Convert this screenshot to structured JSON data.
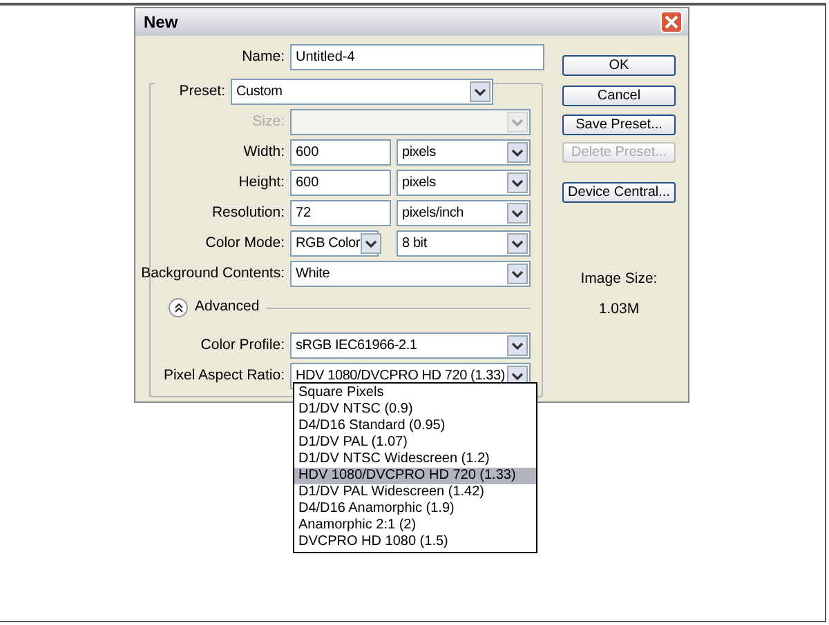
{
  "window": {
    "title": "New"
  },
  "name": {
    "label": "Name:",
    "value": "Untitled-4"
  },
  "preset": {
    "label": "Preset:",
    "value": "Custom"
  },
  "rows": [
    {
      "label": "Size:",
      "disabled": true,
      "fields": [
        {
          "kind": "select"
        }
      ]
    },
    {
      "label": "Width:",
      "disabled": false,
      "fields": [
        {
          "kind": "text",
          "value": "600"
        },
        {
          "kind": "select",
          "value": "pixels"
        }
      ]
    },
    {
      "label": "Height:",
      "disabled": false,
      "fields": [
        {
          "kind": "text",
          "value": "600"
        },
        {
          "kind": "select",
          "value": "pixels"
        }
      ]
    },
    {
      "label": "Resolution:",
      "disabled": false,
      "fields": [
        {
          "kind": "text",
          "value": "72"
        },
        {
          "kind": "select",
          "value": "pixels/inch"
        }
      ]
    },
    {
      "label": "Color Mode:",
      "disabled": false,
      "fields": [
        {
          "kind": "select",
          "value": "RGB Color"
        },
        {
          "kind": "select",
          "value": "8 bit"
        }
      ]
    },
    {
      "label": "Background Contents:",
      "disabled": false,
      "fields": [
        {
          "kind": "select",
          "value": "White"
        }
      ]
    }
  ],
  "advanced": {
    "label": "Advanced",
    "expanded": true
  },
  "advanced_rows": [
    {
      "label": "Color Profile:",
      "disabled": false,
      "fields": [
        {
          "kind": "select",
          "value": "sRGB IEC61966-2.1"
        }
      ]
    },
    {
      "label": "Pixel Aspect Ratio:",
      "disabled": false,
      "fields": [
        {
          "kind": "select",
          "value": "HDV 1080/DVCPRO HD 720 (1.33)"
        }
      ]
    }
  ],
  "buttons": [
    {
      "label": "OK",
      "disabled": false
    },
    {
      "label": "Cancel",
      "disabled": false
    },
    {
      "label": "Save Preset...",
      "disabled": false
    },
    {
      "label": "Delete Preset...",
      "disabled": true
    },
    {
      "label": "Device Central...",
      "disabled": false
    }
  ],
  "image_size": {
    "label": "Image Size:",
    "value": "1.03M"
  },
  "dropdown": {
    "options": [
      {
        "label": "Square Pixels",
        "selected": false
      },
      {
        "label": "D1/DV NTSC (0.9)",
        "selected": false
      },
      {
        "label": "D4/D16 Standard (0.95)",
        "selected": false
      },
      {
        "label": "D1/DV PAL (1.07)",
        "selected": false
      },
      {
        "label": "D1/DV NTSC Widescreen (1.2)",
        "selected": false
      },
      {
        "label": "HDV 1080/DVCPRO HD 720 (1.33)",
        "selected": true
      },
      {
        "label": "D1/DV PAL Widescreen (1.42)",
        "selected": false
      },
      {
        "label": "D4/D16 Anamorphic (1.9)",
        "selected": false
      },
      {
        "label": "Anamorphic 2:1 (2)",
        "selected": false
      },
      {
        "label": "DVCPRO HD 1080 (1.5)",
        "selected": false
      }
    ]
  }
}
